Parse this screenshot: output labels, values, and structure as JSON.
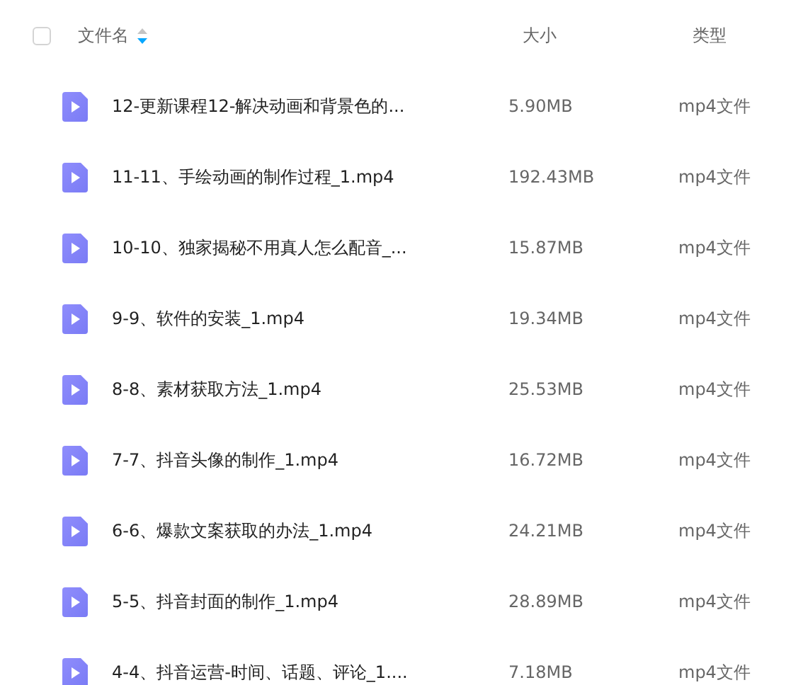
{
  "header": {
    "select_all_checked": false,
    "columns": [
      {
        "label": "文件名",
        "sort_descending": true
      },
      {
        "label": "大小"
      },
      {
        "label": "类型"
      }
    ]
  },
  "files": [
    {
      "name": "12-更新课程12-解决动画和背景色的...",
      "size": "5.90MB",
      "type": "mp4文件",
      "kind": "video"
    },
    {
      "name": "11-11、手绘动画的制作过程_1.mp4",
      "size": "192.43MB",
      "type": "mp4文件",
      "kind": "video"
    },
    {
      "name": "10-10、独家揭秘不用真人怎么配音_...",
      "size": "15.87MB",
      "type": "mp4文件",
      "kind": "video"
    },
    {
      "name": "9-9、软件的安装_1.mp4",
      "size": "19.34MB",
      "type": "mp4文件",
      "kind": "video"
    },
    {
      "name": "8-8、素材获取方法_1.mp4",
      "size": "25.53MB",
      "type": "mp4文件",
      "kind": "video"
    },
    {
      "name": "7-7、抖音头像的制作_1.mp4",
      "size": "16.72MB",
      "type": "mp4文件",
      "kind": "video"
    },
    {
      "name": "6-6、爆款文案获取的办法_1.mp4",
      "size": "24.21MB",
      "type": "mp4文件",
      "kind": "video"
    },
    {
      "name": "5-5、抖音封面的制作_1.mp4",
      "size": "28.89MB",
      "type": "mp4文件",
      "kind": "video"
    },
    {
      "name": "4-4、抖音运营-时间、话题、评论_1....",
      "size": "7.18MB",
      "type": "mp4文件",
      "kind": "video"
    }
  ]
}
